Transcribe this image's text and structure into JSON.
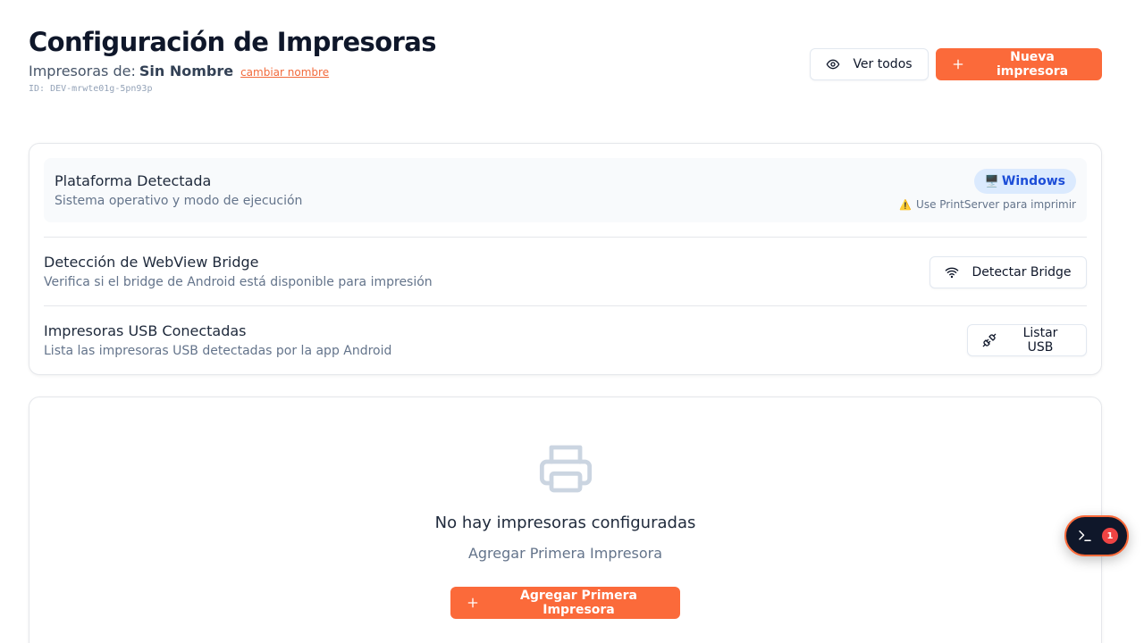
{
  "header": {
    "title": "Configuración de Impresoras",
    "subtitle_prefix": "Impresoras de:",
    "device_name": "Sin Nombre",
    "rename_link": "cambiar nombre",
    "device_id": "ID: DEV-mrwte01g-5pn93p"
  },
  "actions": {
    "view_all": {
      "label": "Ver todos",
      "icon": "eye-icon"
    },
    "new_printer": {
      "label": "Nueva impresora",
      "icon": "plus-icon"
    }
  },
  "platform": {
    "title": "Plataforma Detectada",
    "description": "Sistema operativo y modo de ejecución",
    "badge": "Windows",
    "badge_icon": "🖥️",
    "warning": "Use PrintServer para imprimir",
    "warning_icon": "⚠️"
  },
  "webview": {
    "title": "Detección de WebView Bridge",
    "description": "Verifica si el bridge de Android está disponible para impresión",
    "button": "Detectar Bridge",
    "icon": "wifi-icon"
  },
  "usb": {
    "title": "Impresoras USB Conectadas",
    "description": "Lista las impresoras USB detectadas por la app Android",
    "button": "Listar USB",
    "icon": "plug-icon"
  },
  "empty": {
    "icon": "printer-icon",
    "title": "No hay impresoras configuradas",
    "description": "Agregar Primera Impresora",
    "button": "Agregar Primera Impresora"
  },
  "console": {
    "icon": "terminal-icon",
    "badge": "1"
  },
  "colors": {
    "accent": "#fb6a3a",
    "badge_bg": "#dbeafe",
    "badge_text": "#1d4ed8",
    "console_bg": "#0f172a",
    "notification": "#ef4444"
  }
}
